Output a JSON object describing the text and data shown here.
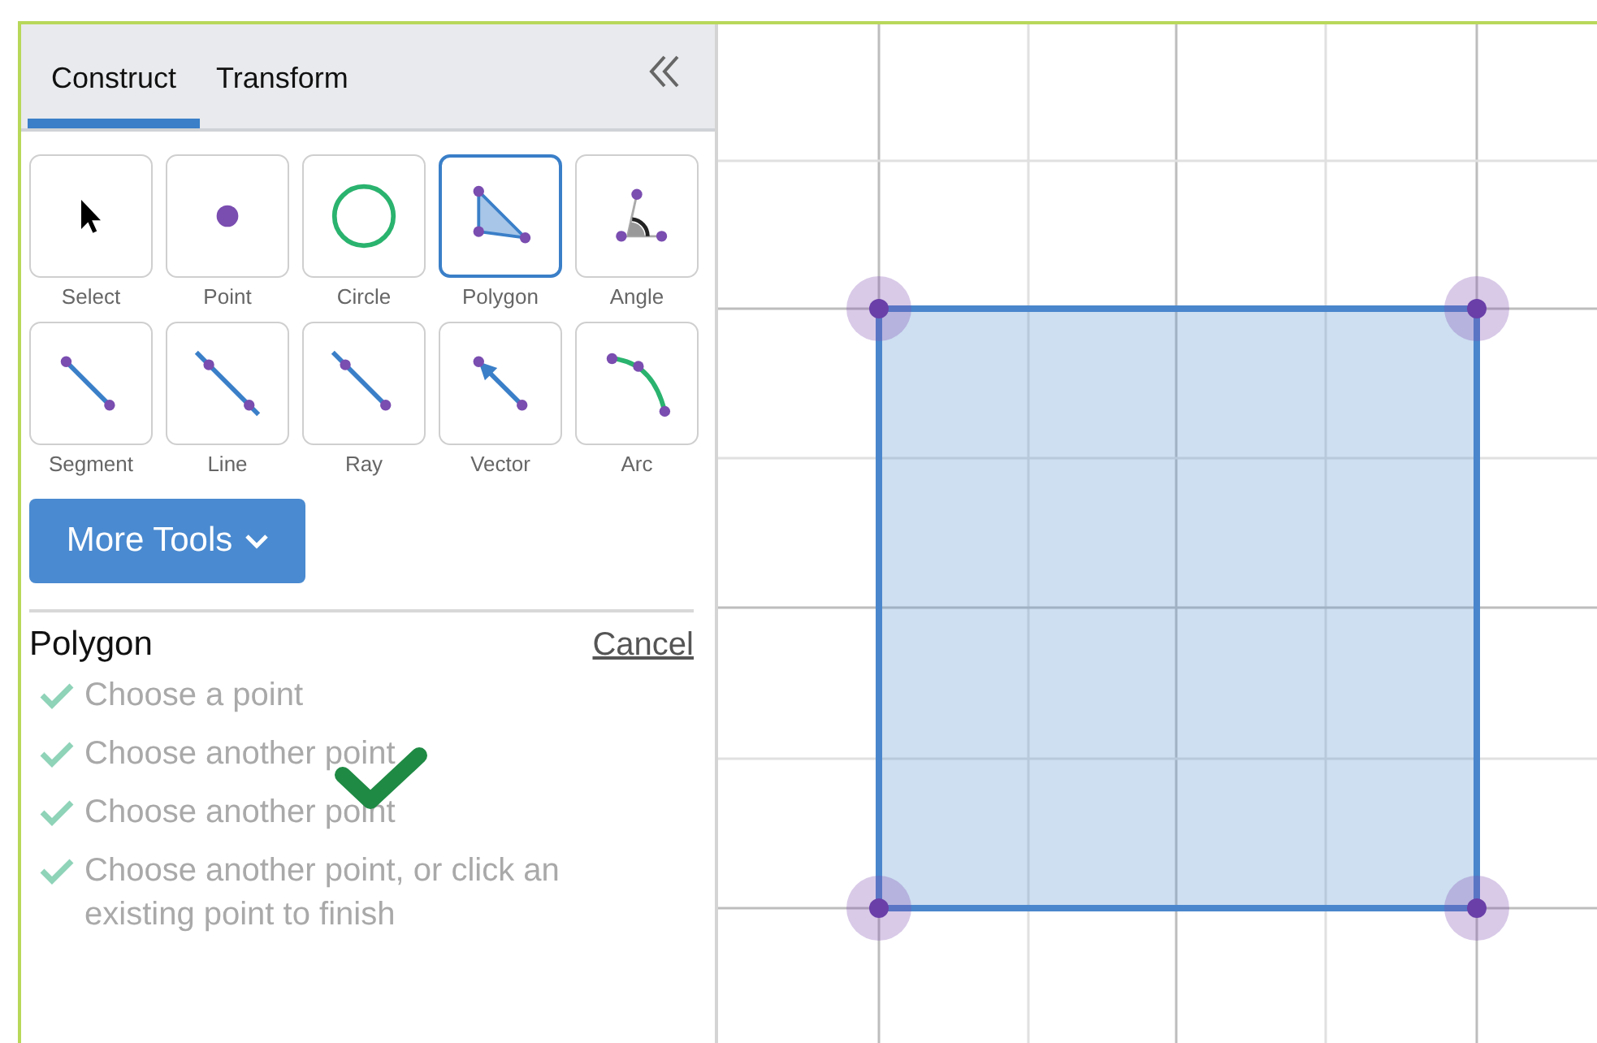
{
  "tabs": [
    {
      "label": "Construct",
      "selected": true
    },
    {
      "label": "Transform",
      "selected": false
    }
  ],
  "tools": [
    {
      "kind": "select",
      "label": "Select",
      "selected": false
    },
    {
      "kind": "point",
      "label": "Point",
      "selected": false
    },
    {
      "kind": "circle",
      "label": "Circle",
      "selected": false
    },
    {
      "kind": "polygon",
      "label": "Polygon",
      "selected": true
    },
    {
      "kind": "angle",
      "label": "Angle",
      "selected": false
    },
    {
      "kind": "segment",
      "label": "Segment",
      "selected": false
    },
    {
      "kind": "line",
      "label": "Line",
      "selected": false
    },
    {
      "kind": "ray",
      "label": "Ray",
      "selected": false
    },
    {
      "kind": "vector",
      "label": "Vector",
      "selected": false
    },
    {
      "kind": "arc",
      "label": "Arc",
      "selected": false
    }
  ],
  "more_button": "More Tools",
  "instructions": {
    "title": "Polygon",
    "cancel": "Cancel",
    "steps": [
      {
        "text": "Choose a point",
        "done": true
      },
      {
        "text": "Choose another point",
        "done": true
      },
      {
        "text": "Choose another point",
        "done": true
      },
      {
        "text": "Choose another point, or click an existing point to finish",
        "done": true
      }
    ]
  }
}
